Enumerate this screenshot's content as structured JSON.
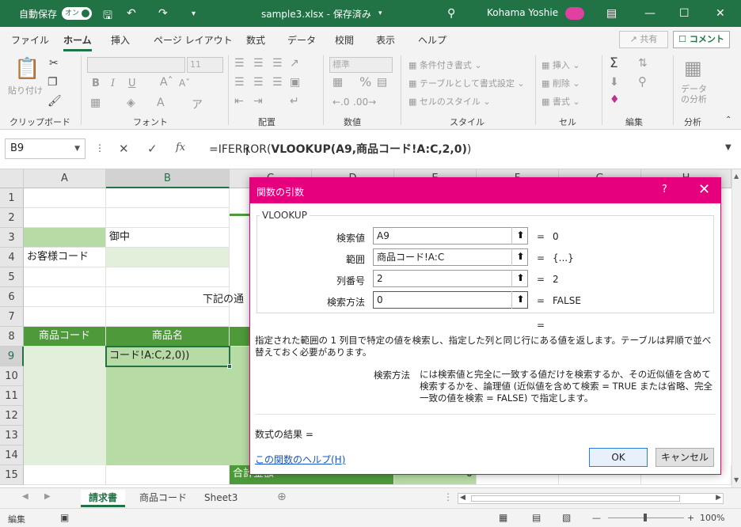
{
  "titlebar": {
    "autosave_label": "自動保存",
    "autosave_state": "オン",
    "filename": "sample3.xlsx - 保存済み",
    "user": "Kohama Yoshie"
  },
  "ribbon_tabs": [
    "ファイル",
    "ホーム",
    "挿入",
    "ページ レイアウト",
    "数式",
    "データ",
    "校閲",
    "表示",
    "ヘルプ"
  ],
  "share_label": "共有",
  "comment_label": "コメント",
  "ribbon": {
    "paste_label": "貼り付け",
    "font_size": "11",
    "number_format": "標準",
    "conditional_format": "条件付き書式",
    "table_format": "テーブルとして書式設定",
    "cell_style": "セルのスタイル",
    "insert": "挿入",
    "delete": "削除",
    "format": "書式",
    "analyze": "データ\nの分析",
    "groups": [
      "クリップボード",
      "フォント",
      "配置",
      "数値",
      "スタイル",
      "セル",
      "編集",
      "分析"
    ]
  },
  "formula_bar": {
    "name_box": "B9",
    "formula_prefix": "=IFERROR(",
    "formula_bold": "VLOOKUP(A9,商品コード!A:C,2,0)",
    "formula_suffix": ")"
  },
  "grid": {
    "columns": [
      "A",
      "B",
      "C",
      "D",
      "E",
      "F",
      "G",
      "H"
    ],
    "rows": [
      "1",
      "2",
      "3",
      "4",
      "5",
      "6",
      "7",
      "8",
      "9",
      "10",
      "11",
      "12",
      "13",
      "14",
      "15"
    ],
    "b3": "御中",
    "a4": "お客様コード",
    "row6_text": "下記の通",
    "a8": "商品コード",
    "b8": "商品名",
    "b9": "コード!A:C,2,0))",
    "c15": "合計金額",
    "e15": "0"
  },
  "sheets": [
    "請求書",
    "商品コード",
    "Sheet3"
  ],
  "status": {
    "mode": "編集",
    "zoom": "100%"
  },
  "dialog": {
    "title": "関数の引数",
    "function_name": "VLOOKUP",
    "args": [
      {
        "label": "検索値",
        "value": "A9",
        "result": "0"
      },
      {
        "label": "範囲",
        "value": "商品コード!A:C",
        "result": "{...}"
      },
      {
        "label": "列番号",
        "value": "2",
        "result": "2"
      },
      {
        "label": "検索方法",
        "value": "0",
        "result": "FALSE"
      }
    ],
    "overall_eq": "=",
    "description": "指定された範囲の 1 列目で特定の値を検索し、指定した列と同じ行にある値を返します。テーブルは昇順で並べ替えておく必要があります。",
    "param_name": "検索方法",
    "param_description": "には検索値と完全に一致する値だけを検索するか、その近似値を含めて検索するかを、論理値 (近似値を含めて検索 = TRUE または省略、完全一致の値を検索 = FALSE) で指定します。",
    "result_label": "数式の結果 =",
    "help_link": "この関数のヘルプ(H)",
    "ok": "OK",
    "cancel": "キャンセル"
  },
  "colors": {
    "excel_green": "#217346",
    "header_green": "#4e9a3a",
    "light_green": "#b7dba5",
    "pale_green": "#e2efda",
    "dialog_accent": "#e6007e"
  }
}
